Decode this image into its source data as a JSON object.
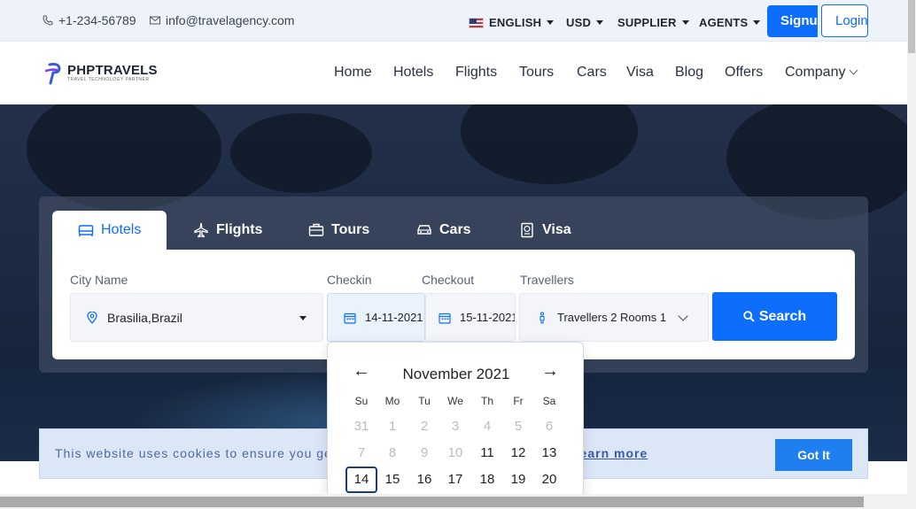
{
  "topbar": {
    "phone": "+1-234-56789",
    "email": "info@travelagency.com",
    "language": "ENGLISH",
    "currency": "USD",
    "supplier": "SUPPLIER",
    "agents": "AGENTS",
    "signup": "Signup",
    "login": "Login"
  },
  "brand": {
    "name": "PHPTRAVELS",
    "tagline": "TRAVEL TECHNOLOGY PARTNER"
  },
  "nav": [
    "Home",
    "Hotels",
    "Flights",
    "Tours",
    "Cars",
    "Visa",
    "Blog",
    "Offers",
    "Company"
  ],
  "tabs": [
    "Hotels",
    "Flights",
    "Tours",
    "Cars",
    "Visa"
  ],
  "form": {
    "city_label": "City Name",
    "city_value": "Brasilia,Brazil",
    "checkin_label": "Checkin",
    "checkin_value": "14-11-2021",
    "checkout_label": "Checkout",
    "checkout_value": "15-11-2021",
    "travellers_label": "Travellers",
    "travellers_value": "Travellers 2 Rooms 1",
    "search_label": "Search"
  },
  "datepicker": {
    "prev": "←",
    "next": "→",
    "month_title": "November 2021",
    "weekdays": [
      "Su",
      "Mo",
      "Tu",
      "We",
      "Th",
      "Fr",
      "Sa"
    ],
    "weeks": [
      [
        "31",
        "1",
        "2",
        "3",
        "4",
        "5",
        "6"
      ],
      [
        "7",
        "8",
        "9",
        "10",
        "11",
        "12",
        "13"
      ],
      [
        "14",
        "15",
        "16",
        "17",
        "18",
        "19",
        "20"
      ]
    ],
    "selected_day": "14"
  },
  "cookie": {
    "text": "This website uses cookies to ensure you get the best experience on our website. ",
    "link": "Learn more",
    "button": "Got It"
  },
  "colors": {
    "primary": "#0d6efd",
    "topbar_bg": "#eef3fb",
    "cookie_bg": "#dbe6f7"
  }
}
